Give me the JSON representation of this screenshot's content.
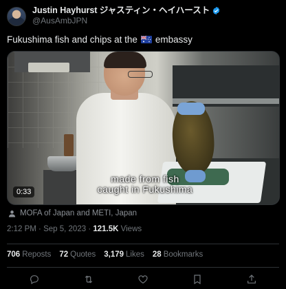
{
  "author": {
    "display_name": "Justin Hayhurst ジャスティン・ヘイハースト",
    "handle": "@AusAmbJPN",
    "verified_icon": "verified-badge-icon",
    "avatar": "profile-photo"
  },
  "tweet": {
    "text_before_flag": "Fukushima fish and chips at the",
    "flag_icon": "australia-flag-icon",
    "text_after_flag": "embassy"
  },
  "media": {
    "type": "video",
    "caption_line1": "made from fish",
    "caption_line2": "caught in Fukushima",
    "duration": "0:33"
  },
  "attribution": {
    "icon": "person-icon",
    "text": "MOFA of Japan and METI, Japan"
  },
  "meta": {
    "time": "2:12 PM",
    "separator": "·",
    "date": "Sep 5, 2023",
    "views_count": "121.5K",
    "views_label": "Views"
  },
  "stats": [
    {
      "count": "706",
      "label": "Reposts"
    },
    {
      "count": "72",
      "label": "Quotes"
    },
    {
      "count": "3,179",
      "label": "Likes"
    },
    {
      "count": "28",
      "label": "Bookmarks"
    }
  ],
  "actions": [
    {
      "name": "reply-icon"
    },
    {
      "name": "repost-icon"
    },
    {
      "name": "like-icon"
    },
    {
      "name": "bookmark-icon"
    },
    {
      "name": "share-icon"
    }
  ],
  "colors": {
    "background": "#000000",
    "primary_text": "#e7e9ea",
    "secondary_text": "#71767b",
    "divider": "#2f3336",
    "verified": "#1d9bf0"
  }
}
